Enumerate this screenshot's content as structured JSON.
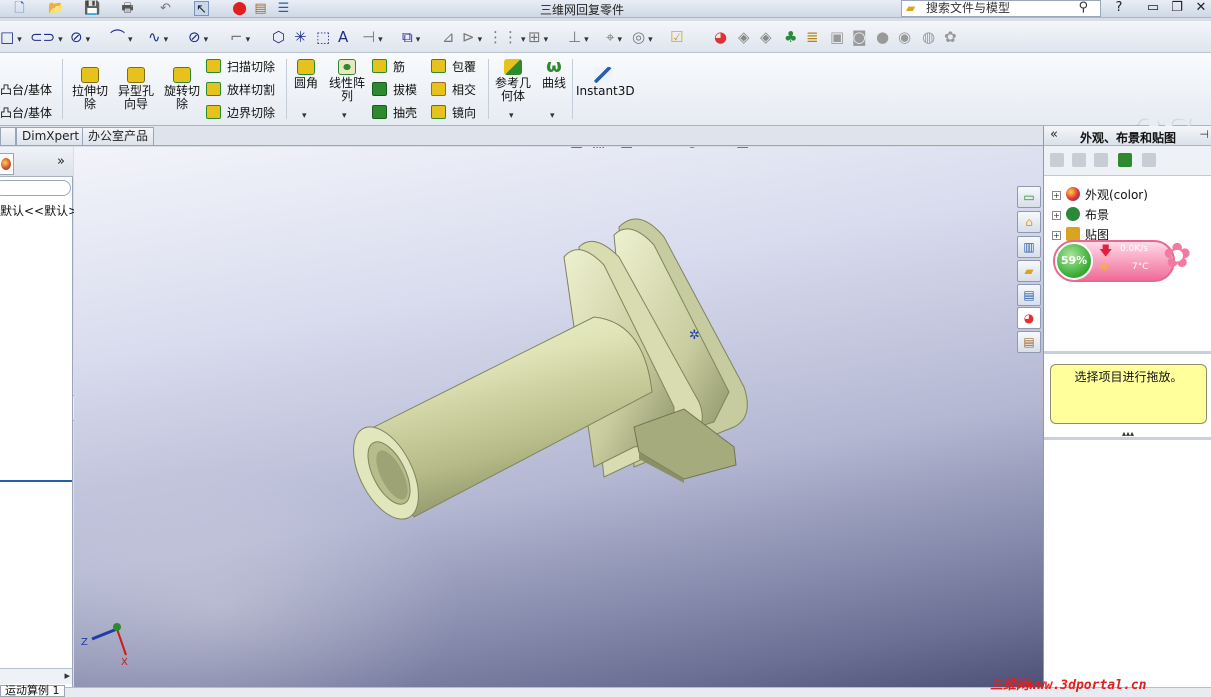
{
  "window": {
    "title": "三维网回复零件",
    "search_placeholder": "搜索文件与模型",
    "help_label": "?"
  },
  "ribbon": {
    "partial_left_1": "凸台/基体",
    "partial_left_2": "凸台/基体",
    "extrude_cut": "拉伸切\n除",
    "hole_wizard": "异型孔\n向导",
    "revolve_cut": "旋转切\n除",
    "swept_cut": "扫描切除",
    "lofted_cut": "放样切割",
    "boundary_cut": "边界切除",
    "fillet": "圆角",
    "linear_pattern": "线性阵\n列",
    "rib": "筋",
    "draft": "拔模",
    "shell": "抽壳",
    "wrap": "包覆",
    "intersect": "相交",
    "mirror": "镜向",
    "ref_geometry": "参考几\n何体",
    "curves": "曲线",
    "instant3d": "Instant3D"
  },
  "tabs": [
    "DimXpert",
    "办公室产品"
  ],
  "left_panel": {
    "config_text": "默认<<默认>_",
    "bottom_tab": "运动算例 1"
  },
  "task_pane": {
    "title": "外观、布景和贴图",
    "tree": [
      {
        "label": "外观(color)",
        "color": "#d33"
      },
      {
        "label": "布景",
        "color": "#2a8a3a"
      },
      {
        "label": "贴图",
        "color": "#d9a520"
      }
    ],
    "message": "选择项目进行拖放。"
  },
  "widget": {
    "percent": "59%",
    "speed": "0.0K/s",
    "temp": "7°C"
  },
  "triad": {
    "x": "X",
    "y": "Y",
    "z": "Z"
  },
  "watermark": "三维网www.3dportal.cn",
  "colors": {
    "part_body": "#e4e8c2",
    "part_shadow": "#8c9266",
    "viewport_top": "#f3f4fa",
    "viewport_bottom": "#4e5176"
  }
}
